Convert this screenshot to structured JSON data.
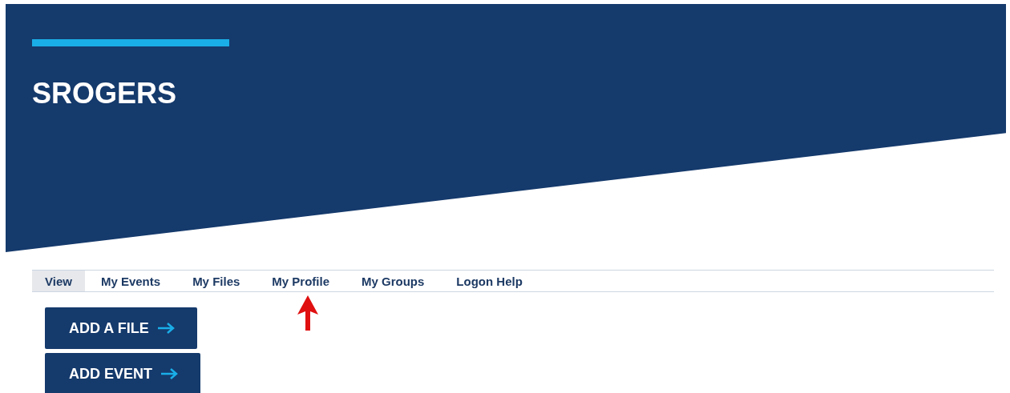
{
  "header": {
    "title": "SROGERS"
  },
  "tabs": [
    {
      "label": "View",
      "selected": true
    },
    {
      "label": "My Events",
      "selected": false
    },
    {
      "label": "My Files",
      "selected": false
    },
    {
      "label": "My Profile",
      "selected": false
    },
    {
      "label": "My Groups",
      "selected": false
    },
    {
      "label": "Logon Help",
      "selected": false
    }
  ],
  "buttons": [
    "ADD A FILE",
    "ADD EVENT"
  ]
}
